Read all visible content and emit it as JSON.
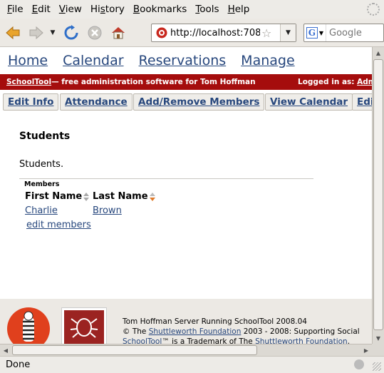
{
  "menu": {
    "items": [
      {
        "u": "F",
        "rest": "ile"
      },
      {
        "u": "E",
        "rest": "dit"
      },
      {
        "u": "V",
        "rest": "iew"
      },
      {
        "pre": "Hi",
        "u": "s",
        "rest": "tory"
      },
      {
        "u": "B",
        "rest": "ookmarks"
      },
      {
        "u": "T",
        "rest": "ools"
      },
      {
        "u": "H",
        "rest": "elp"
      }
    ]
  },
  "toolbar": {
    "url": "http://localhost:708",
    "search_placeholder": "Google"
  },
  "site_nav": [
    "Home",
    "Calendar",
    "Reservations",
    "Manage"
  ],
  "banner": {
    "brand": "SchoolTool",
    "tagline": " — free administration software for Tom Hoffman",
    "logged_in_label": "Logged in as: ",
    "user": "Admi"
  },
  "tabs": [
    "Edit Info",
    "Attendance",
    "Add/Remove Members",
    "View Calendar",
    "Edi"
  ],
  "page": {
    "title": "Students",
    "description": "Students.",
    "members_label": "Members",
    "columns": [
      "First Name",
      "Last Name"
    ],
    "rows": [
      [
        "Charlie",
        "Brown"
      ]
    ],
    "edit_members": "edit members"
  },
  "footer": {
    "line1": "Tom Hoffman Server Running SchoolTool 2008.04",
    "line2_pre": "© The ",
    "line2_link": "Shuttleworth Foundation",
    "line2_post": " 2003 - 2008: Supporting Social",
    "line3_link": "SchoolTool",
    "line3_mid": "™ is a Trademark of The ",
    "line3_link2": "Shuttleworth Foundation",
    "line3_post": "."
  },
  "status": {
    "text": "Done"
  },
  "colors": {
    "link": "#27477d",
    "banner": "#a50d0d",
    "sort_active": "#e07a2a"
  }
}
